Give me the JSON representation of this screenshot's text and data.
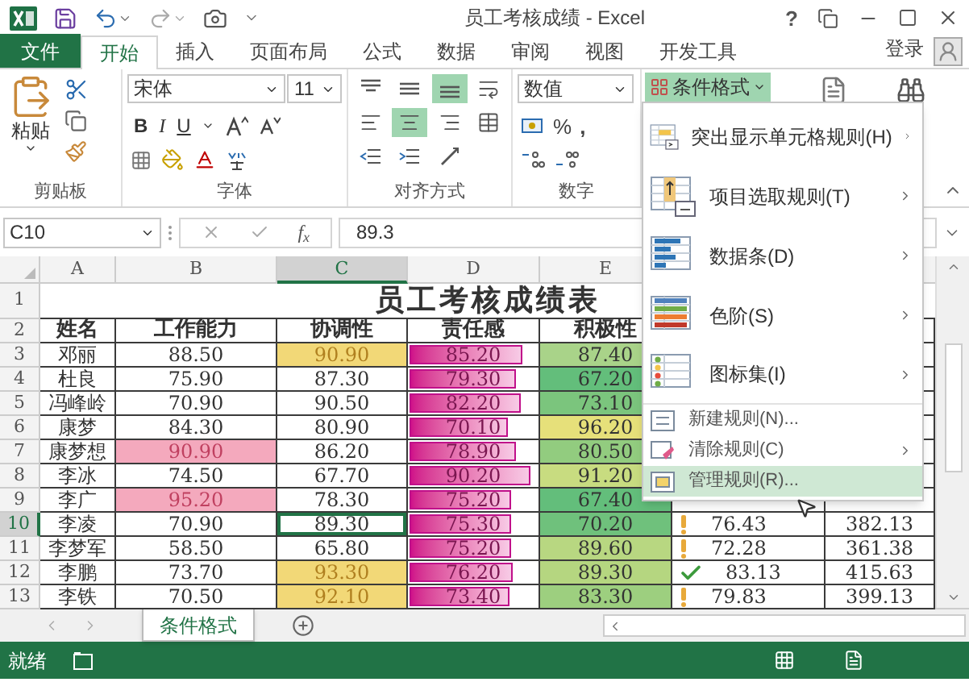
{
  "title_bar": {
    "title": "员工考核成绩 - Excel",
    "help": "?"
  },
  "ribbon_tabs": [
    {
      "label": "文件",
      "kind": "file",
      "selected": false
    },
    {
      "label": "开始",
      "kind": "tab",
      "selected": true
    },
    {
      "label": "插入",
      "kind": "tab",
      "selected": false
    },
    {
      "label": "页面布局",
      "kind": "tab",
      "selected": false
    },
    {
      "label": "公式",
      "kind": "tab",
      "selected": false
    },
    {
      "label": "数据",
      "kind": "tab",
      "selected": false
    },
    {
      "label": "审阅",
      "kind": "tab",
      "selected": false
    },
    {
      "label": "视图",
      "kind": "tab",
      "selected": false
    },
    {
      "label": "开发工具",
      "kind": "tab",
      "selected": false
    }
  ],
  "account": {
    "label": "登录"
  },
  "ribbon": {
    "clipboard": {
      "paste": "粘贴",
      "label": "剪贴板"
    },
    "font": {
      "name": "宋体",
      "size": "11",
      "bold": "B",
      "italic": "I",
      "underline": "U",
      "label": "字体"
    },
    "alignment": {
      "label": "对齐方式",
      "buttons": [
        {
          "kind": "top",
          "selected": false
        },
        {
          "kind": "middle",
          "selected": false
        },
        {
          "kind": "bottom",
          "selected": true
        },
        {
          "kind": "wrap",
          "selected": false
        },
        {
          "kind": "left",
          "selected": false
        },
        {
          "kind": "center",
          "selected": true
        },
        {
          "kind": "right",
          "selected": false
        },
        {
          "kind": "merge",
          "selected": false
        },
        {
          "kind": "outdent",
          "selected": false
        },
        {
          "kind": "indent",
          "selected": false
        },
        {
          "kind": "orientation",
          "selected": false
        }
      ]
    },
    "number": {
      "format": "数值",
      "percent": "%",
      "comma": ",",
      "label": "数字"
    },
    "conditional_format": {
      "label": "条件格式",
      "selected": true
    }
  },
  "formula_bar": {
    "name_box": "C10",
    "function": "f$_{x}$",
    "value": "89.3"
  },
  "columns": [
    {
      "label": "A",
      "selected": false
    },
    {
      "label": "B",
      "selected": false
    },
    {
      "label": "C",
      "selected": true
    },
    {
      "label": "D",
      "selected": false
    },
    {
      "label": "E",
      "selected": false
    }
  ],
  "title_row": {
    "row": "1",
    "text": "员工考核成绩表"
  },
  "header_row": {
    "row": "2",
    "cells": [
      "姓名",
      "工作能力",
      "协调性",
      "责任感",
      "积极性"
    ]
  },
  "rows": [
    {
      "row": "3",
      "selected": false,
      "name": "邓丽",
      "b": {
        "text": "88.50",
        "highlight": false
      },
      "c": {
        "text": "90.90",
        "highlight": true,
        "active": false
      },
      "d": {
        "text": "85.20",
        "level": 0.87
      },
      "e": {
        "text": "87.40",
        "color": "#a9d389"
      }
    },
    {
      "row": "4",
      "selected": false,
      "name": "杜良",
      "b": {
        "text": "75.90",
        "highlight": false
      },
      "c": {
        "text": "87.30",
        "highlight": false,
        "active": false
      },
      "d": {
        "text": "79.30",
        "level": 0.82
      },
      "e": {
        "text": "67.20",
        "color": "#63be7b"
      }
    },
    {
      "row": "5",
      "selected": false,
      "name": "冯峰岭",
      "b": {
        "text": "70.90",
        "highlight": false
      },
      "c": {
        "text": "90.50",
        "highlight": false,
        "active": false
      },
      "d": {
        "text": "82.20",
        "level": 0.85
      },
      "e": {
        "text": "73.10",
        "color": "#7bc57d"
      }
    },
    {
      "row": "6",
      "selected": false,
      "name": "康梦",
      "b": {
        "text": "84.30",
        "highlight": false
      },
      "c": {
        "text": "80.90",
        "highlight": false,
        "active": false
      },
      "d": {
        "text": "70.10",
        "level": 0.75
      },
      "e": {
        "text": "96.20",
        "color": "#e6e07a"
      }
    },
    {
      "row": "7",
      "selected": false,
      "name": "康梦想",
      "b": {
        "text": "90.90",
        "highlight": true
      },
      "c": {
        "text": "86.20",
        "highlight": false,
        "active": false
      },
      "d": {
        "text": "78.90",
        "level": 0.81
      },
      "e": {
        "text": "80.50",
        "color": "#92cc7f"
      }
    },
    {
      "row": "8",
      "selected": false,
      "name": "李冰",
      "b": {
        "text": "74.50",
        "highlight": false
      },
      "c": {
        "text": "67.70",
        "highlight": false,
        "active": false
      },
      "d": {
        "text": "90.20",
        "level": 0.93
      },
      "e": {
        "text": "91.20",
        "color": "#c8dc80"
      }
    },
    {
      "row": "9",
      "selected": false,
      "name": "李广",
      "b": {
        "text": "95.20",
        "highlight": true
      },
      "c": {
        "text": "78.30",
        "highlight": false,
        "active": false
      },
      "d": {
        "text": "75.20",
        "level": 0.78
      },
      "e": {
        "text": "67.40",
        "color": "#63be7b"
      }
    },
    {
      "row": "10",
      "selected": true,
      "name": "李凌",
      "b": {
        "text": "70.90",
        "highlight": false
      },
      "c": {
        "text": "89.30",
        "highlight": false,
        "active": true
      },
      "d": {
        "text": "75.30",
        "level": 0.78
      },
      "e": {
        "text": "70.20",
        "color": "#6fc17c"
      },
      "f": {
        "text": "76.43",
        "kind": "warning"
      },
      "g": "382.13"
    },
    {
      "row": "11",
      "selected": false,
      "name": "李梦军",
      "b": {
        "text": "58.50",
        "highlight": false
      },
      "c": {
        "text": "65.80",
        "highlight": false,
        "active": false
      },
      "d": {
        "text": "75.20",
        "level": 0.78
      },
      "e": {
        "text": "89.60",
        "color": "#b8d781"
      },
      "f": {
        "text": "72.28",
        "kind": "warning"
      },
      "g": "361.38"
    },
    {
      "row": "12",
      "selected": false,
      "name": "李鹏",
      "b": {
        "text": "73.70",
        "highlight": false
      },
      "c": {
        "text": "93.30",
        "highlight": true,
        "active": false
      },
      "d": {
        "text": "76.20",
        "level": 0.79
      },
      "e": {
        "text": "89.30",
        "color": "#b5d680"
      },
      "f": {
        "text": "83.13",
        "kind": "check"
      },
      "g": "415.63"
    },
    {
      "row": "13",
      "selected": false,
      "name": "李铁",
      "b": {
        "text": "70.50",
        "highlight": false
      },
      "c": {
        "text": "92.10",
        "highlight": true,
        "active": false
      },
      "d": {
        "text": "73.40",
        "level": 0.76
      },
      "e": {
        "text": "83.30",
        "color": "#9dcf7f"
      },
      "f": {
        "text": "79.83",
        "kind": "warning"
      },
      "g": "399.13"
    }
  ],
  "menu": {
    "items": [
      {
        "label": "突出显示单元格规则(H)",
        "kind": "highlight",
        "submenu": true,
        "selected": false
      },
      {
        "label": "项目选取规则(T)",
        "kind": "top",
        "submenu": true,
        "selected": false
      },
      {
        "label": "数据条(D)",
        "kind": "databar",
        "submenu": true,
        "selected": false
      },
      {
        "label": "色阶(S)",
        "kind": "colorscale",
        "submenu": true,
        "selected": false
      },
      {
        "label": "图标集(I)",
        "kind": "iconset",
        "submenu": true,
        "selected": false
      },
      {
        "label": "新建规则(N)...",
        "kind": "new",
        "submenu": false,
        "selected": false
      },
      {
        "label": "清除规则(C)",
        "kind": "clear",
        "submenu": true,
        "selected": false
      },
      {
        "label": "管理规则(R)...",
        "kind": "manage",
        "submenu": false,
        "selected": true
      }
    ]
  },
  "sheet_tabs": [
    {
      "label": "条件格式",
      "selected": true
    }
  ],
  "status_bar": {
    "text": "就绪"
  }
}
